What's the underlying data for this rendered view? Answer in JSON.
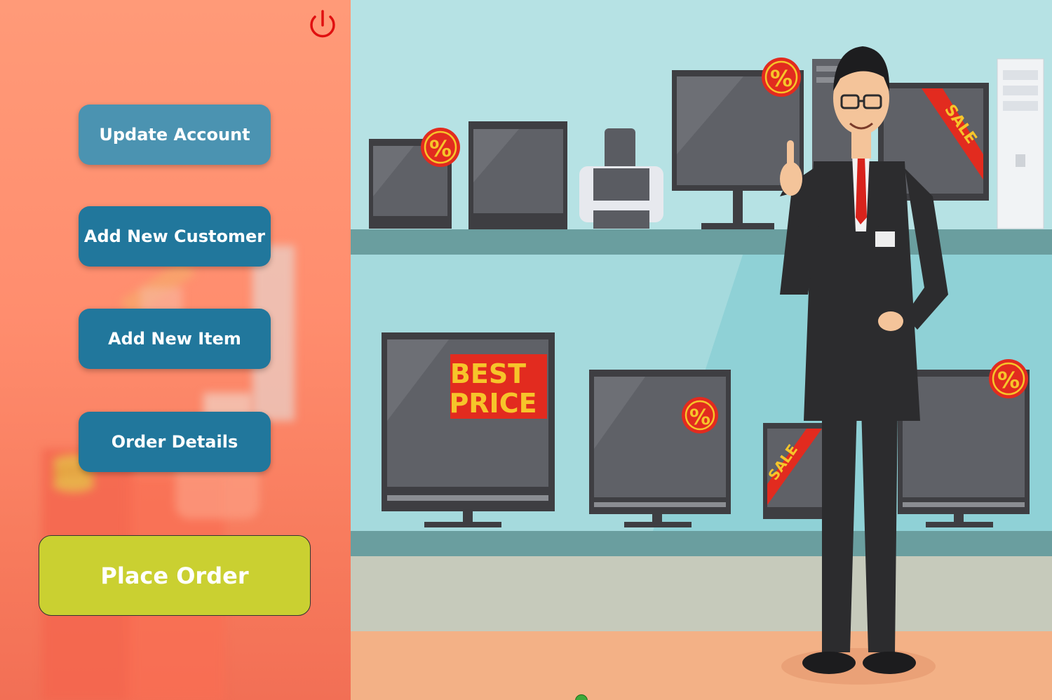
{
  "menu": {
    "update_account": "Update Account",
    "add_new_customer": "Add New Customer",
    "add_new_item": "Add New Item",
    "order_details": "Order Details",
    "place_order": "Place Order"
  },
  "illustration": {
    "best_price_line1": "BEST",
    "best_price_line2": "PRICE",
    "sale_tag": "SALE",
    "percent_badge": "%"
  },
  "colors": {
    "panel_bg": "#ff9a78",
    "button_light": "#4b93b1",
    "button_dark": "#21779c",
    "place_order": "#cad031",
    "power_icon": "#e01010",
    "wall": "#b6e2e4",
    "shelf": "#6a9e9f",
    "floor": "#f3b186"
  }
}
